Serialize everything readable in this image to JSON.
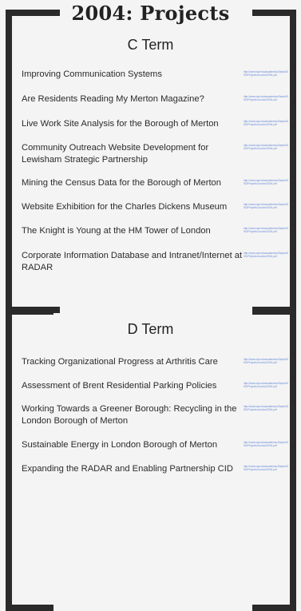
{
  "title": "2004: Projects",
  "c_term": {
    "heading": "C Term",
    "projects": [
      {
        "name": "Improving Communication Systems",
        "link": "http://www.wpi.edu/academics/Depts/IGSD/Projects/London/2004.pdf"
      },
      {
        "name": "Are Residents Reading My Merton Magazine?",
        "link": "http://www.wpi.edu/academics/Depts/IGSD/Projects/London/2004.pdf"
      },
      {
        "name": "Live Work Site Analysis for the Borough of Merton",
        "link": "http://www.wpi.edu/academics/Depts/IGSD/Projects/London/2004.pdf"
      },
      {
        "name": "Community Outreach Website Development for Lewisham Strategic Partnership",
        "link": "http://www.wpi.edu/academics/Depts/IGSD/Projects/London/2004.pdf"
      },
      {
        "name": "Mining the Census Data for the Borough of Merton",
        "link": "http://www.wpi.edu/academics/Depts/IGSD/Projects/London/2004.pdf"
      },
      {
        "name": "Website Exhibition for the Charles Dickens Museum",
        "link": "http://www.wpi.edu/academics/Depts/IGSD/Projects/London/2004.pdf"
      },
      {
        "name": "The Knight is Young at the HM Tower of London",
        "link": "http://www.wpi.edu/academics/Depts/IGSD/Projects/London/2004.pdf"
      },
      {
        "name": "Corporate Information Database and Intranet/Internet at RADAR",
        "link": "http://www.wpi.edu/academics/Depts/IGSD/Projects/London/2004.pdf"
      }
    ]
  },
  "d_term": {
    "heading": "D Term",
    "projects": [
      {
        "name": "Tracking Organizational Progress at Arthritis Care",
        "link": "http://www.wpi.edu/academics/Depts/IGSD/Projects/London/2004.pdf"
      },
      {
        "name": "Assessment of Brent Residential Parking Policies",
        "link": "http://www.wpi.edu/academics/Depts/IGSD/Projects/London/2004.pdf"
      },
      {
        "name": "Working Towards a Greener Borough: Recycling in the London Borough of Merton",
        "link": "http://www.wpi.edu/academics/Depts/IGSD/Projects/London/2004.pdf"
      },
      {
        "name": "Sustainable Energy in London Borough of Merton",
        "link": "http://www.wpi.edu/academics/Depts/IGSD/Projects/London/2004.pdf"
      },
      {
        "name": "Expanding the RADAR and Enabling Partnership CID",
        "link": "http://www.wpi.edu/academics/Depts/IGSD/Projects/London/2004.pdf"
      }
    ]
  }
}
